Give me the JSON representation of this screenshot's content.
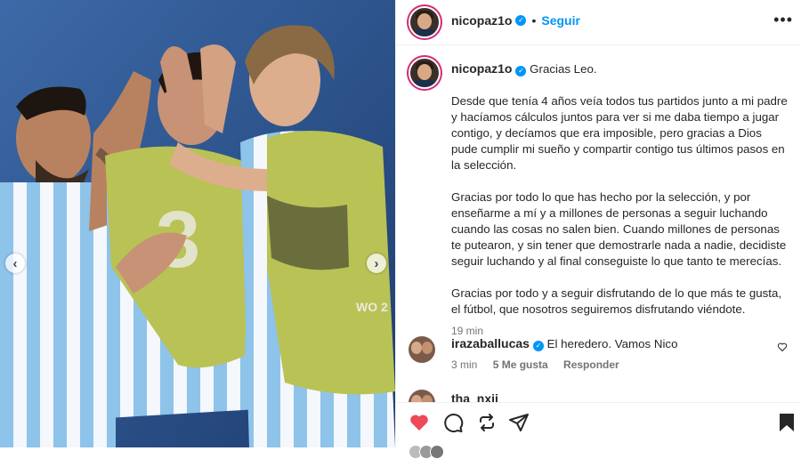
{
  "post": {
    "username": "nicopaz1o",
    "follow_label": "Seguir",
    "more_label": "•••",
    "separator": "•"
  },
  "caption": {
    "username": "nicopaz1o",
    "first_line": "Gracias Leo.",
    "paragraphs": [
      "Desde que tenía 4 años veía todos tus partidos junto a mi padre y hacíamos cálculos juntos para ver si me daba tiempo a jugar contigo, y decíamos que era imposible, pero gracias a Dios pude cumplir mi sueño y compartir contigo tus últimos pasos en la selección.",
      "Gracias por todo lo que has hecho por la selección, y por enseñarme a mí y a millones de personas a seguir luchando cuando las cosas no salen bien. Cuando millones de personas te putearon, y sin tener que demostrarle nada a nadie, decidiste seguir luchando y al final conseguiste lo que tanto te merecías.",
      "Gracias por todo y a seguir disfrutando de lo que más te gusta, el fútbol, que nosotros seguiremos disfrutando viéndote."
    ],
    "time": "19 min"
  },
  "comments": [
    {
      "username": "irazaballucas",
      "text": "El heredero. Vamos Nico",
      "time": "3 min",
      "likes": "5 Me gusta",
      "reply": "Responder"
    },
    {
      "username": "tha_nxii"
    }
  ],
  "photo": {
    "jersey_number": "3",
    "jersey_text": "WO 2"
  },
  "colors": {
    "accent": "#0095f6",
    "like": "#ed4956"
  }
}
